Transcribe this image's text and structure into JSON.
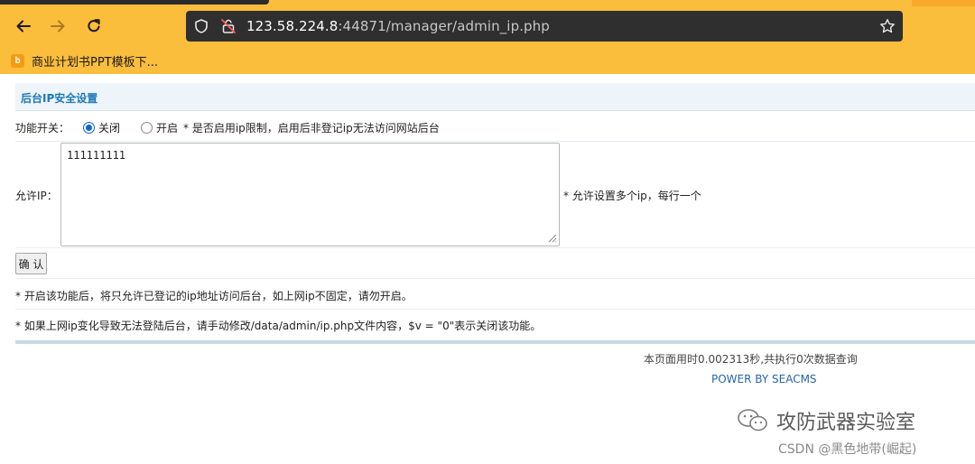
{
  "browser": {
    "url_main": "123.58.224.8",
    "url_rest": ":44871/manager/admin_ip.php",
    "bookmark_label": "商业计划书PPT模板下...",
    "bookmark_favicon": "b",
    "accent_color": "#fbbd3c"
  },
  "panel": {
    "title": "后台IP安全设置"
  },
  "form": {
    "switch_label": "功能开关：",
    "option_off": "关闭",
    "option_on": "开启",
    "switch_hint": "* 是否启用ip限制，启用后非登记ip无法访问网站后台",
    "selected": "关闭",
    "allow_ip_label": "允许IP：",
    "allow_ip_value": "111111111",
    "allow_ip_hint": "* 允许设置多个ip，每行一个",
    "confirm_label": "确 认",
    "note1": "* 开启该功能后，将只允许已登记的ip地址访问后台，如上网ip不固定，请勿开启。",
    "note2": "* 如果上网ip变化导致无法登陆后台，请手动修改/data/admin/ip.php文件内容，$v = \"0\"表示关闭该功能。"
  },
  "footer": {
    "timing": "本页面用时0.002313秒,共执行0次数据查询",
    "powered": "POWER BY SEACMS"
  },
  "watermark": {
    "main": "攻防武器实验室",
    "sub": "CSDN @黑色地带(崛起)"
  }
}
